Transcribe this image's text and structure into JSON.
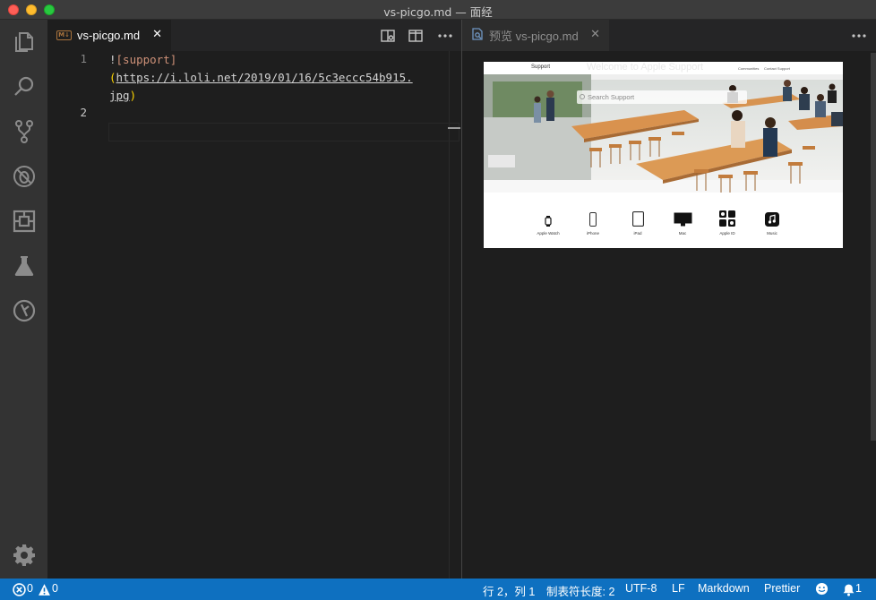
{
  "window": {
    "title": "vs-picgo.md — 面经"
  },
  "activity_bar": {
    "items": [
      {
        "icon": "files-icon"
      },
      {
        "icon": "search-icon"
      },
      {
        "icon": "source-control-icon"
      },
      {
        "icon": "debug-icon"
      },
      {
        "icon": "extensions-icon"
      },
      {
        "icon": "flask-icon"
      },
      {
        "icon": "git-graph-icon"
      }
    ],
    "settings_icon": "gear-icon"
  },
  "editor": {
    "tab": {
      "icon_text": "M↓",
      "label": "vs-picgo.md",
      "close": "✕"
    },
    "actions": [
      "open-preview-icon",
      "split-editor-icon",
      "more-icon"
    ],
    "line_numbers": [
      "1",
      "2"
    ],
    "code": {
      "bang": "!",
      "alt": "[support]",
      "open_paren": "(",
      "url_part1": "https://i.loli.net/2019/01/16/5c3eccc54b915.",
      "url_part2": "jpg",
      "close_paren": ")"
    }
  },
  "preview": {
    "tab": {
      "label": "预览 vs-picgo.md",
      "close": "✕"
    },
    "more": "more-icon",
    "image": {
      "brand": "Support",
      "nav_links": [
        "Communities",
        "Contact Support"
      ],
      "welcome": "Welcome to Apple Support",
      "search_placeholder": "Search Support",
      "products": [
        "Apple Watch",
        "iPhone",
        "iPad",
        "Mac",
        "Apple ID",
        "Music"
      ]
    }
  },
  "status_bar": {
    "errors": "0",
    "warnings": "0",
    "position": "行 2，列 1",
    "tab_size": "制表符长度: 2",
    "encoding": "UTF-8",
    "eol": "LF",
    "language": "Markdown",
    "formatter": "Prettier",
    "notifications": "1"
  },
  "colors": {
    "status_bar": "#0e70c0",
    "activity_bar": "#333333",
    "editor_bg": "#1e1e1e",
    "string_orange": "#ce9178",
    "paren_gold": "#ffd700"
  }
}
